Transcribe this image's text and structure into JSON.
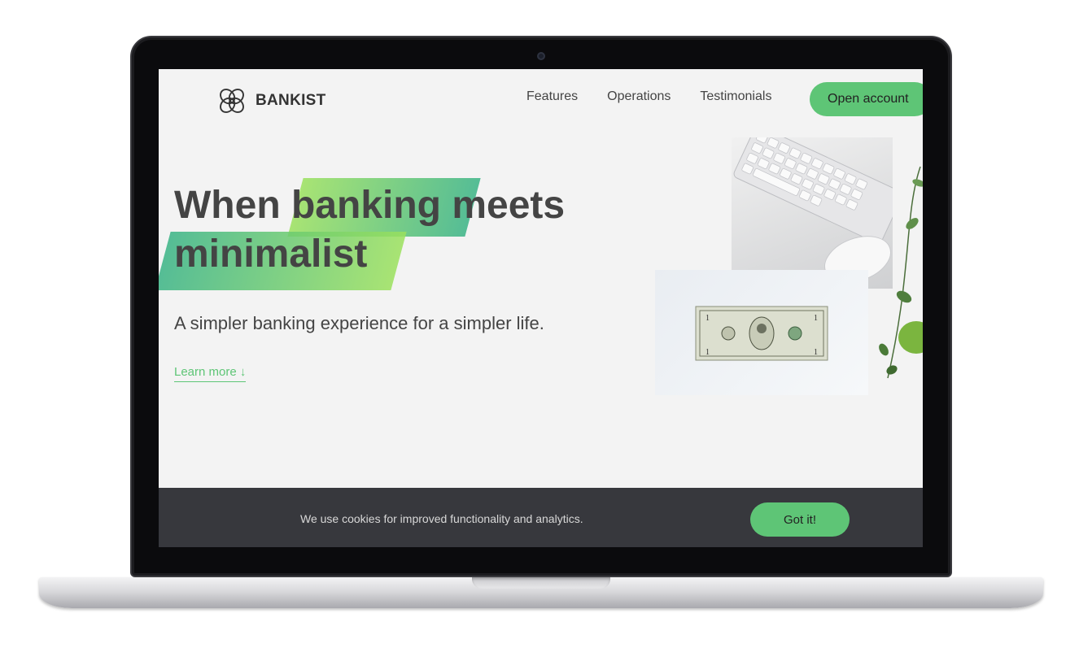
{
  "nav": {
    "logo_text": "BANKIST",
    "links": [
      "Features",
      "Operations",
      "Testimonials"
    ],
    "cta": "Open account"
  },
  "hero": {
    "title_word1": "When",
    "title_highlight1": "banking",
    "title_word2": "meets",
    "title_highlight2": "minimalist",
    "subtitle": "A simpler banking experience for a simpler life.",
    "learn_more": "Learn more ↓"
  },
  "cookie": {
    "message": "We use cookies for improved functionality and analytics.",
    "button": "Got it!"
  },
  "colors": {
    "accent": "#5ec576",
    "gradient_start": "#39b385",
    "gradient_end": "#9be15d",
    "text": "#444444",
    "cookie_bg": "#37383d"
  },
  "icons": [
    "bankist-logo-icon",
    "keyboard-image",
    "dollar-bill-image",
    "plant-image"
  ]
}
